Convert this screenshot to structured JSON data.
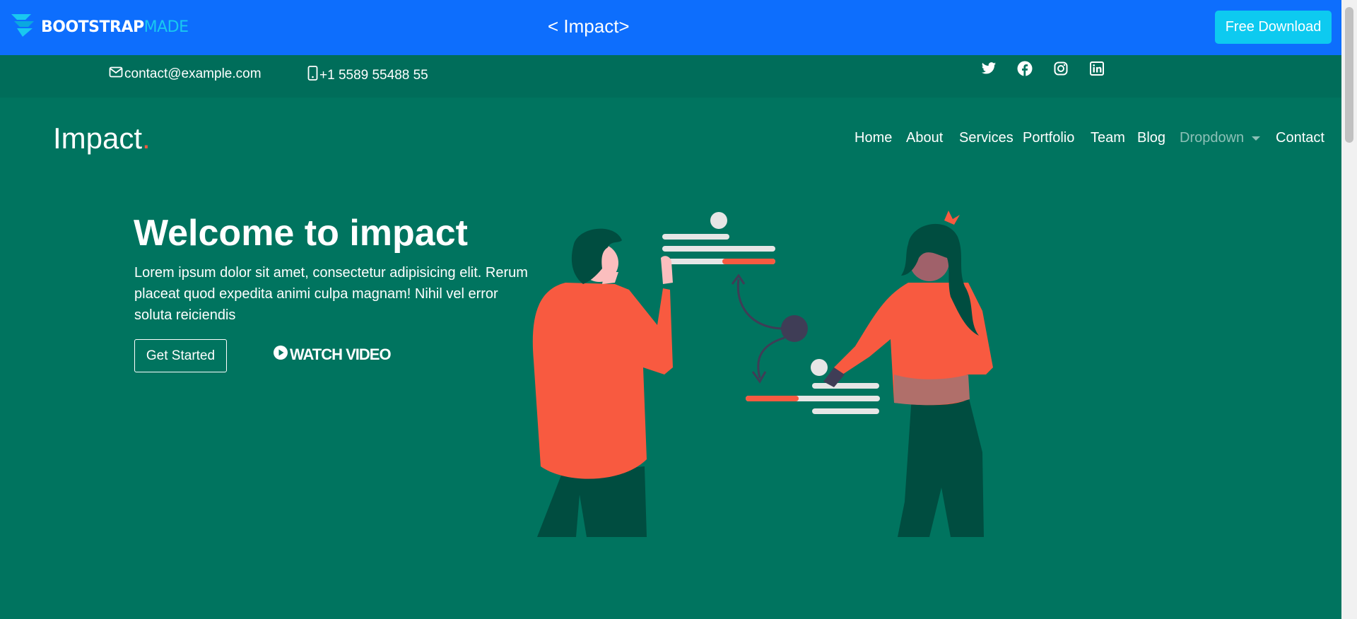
{
  "banner": {
    "logo_part1": "BOOTSTRAP",
    "logo_part2": "MADE",
    "title": "< Impact>",
    "download_label": "Free Download",
    "color": "#0d6efd",
    "download_color": "#0dcaf0"
  },
  "topbar": {
    "email": "contact@example.com",
    "phone": "+1 5589 55488 55",
    "email_icon": "envelope-icon",
    "phone_icon": "phone-icon",
    "socials": [
      "twitter-icon",
      "facebook-icon",
      "instagram-icon",
      "linkedin-icon"
    ]
  },
  "header": {
    "brand": "Impact",
    "brand_dot": ".",
    "nav": [
      "Home",
      "About",
      "Services",
      "Portfolio",
      "Team",
      "Blog",
      "Dropdown",
      "Contact"
    ]
  },
  "hero": {
    "title": "Welcome to impact",
    "description": "Lorem ipsum dolor sit amet, consectetur adipisicing elit. Rerum placeat quod expedita animi culpa magnam! Nihil vel error soluta reiciendis",
    "cta_label": "Get Started",
    "video_label": "WATCH VIDEO",
    "video_icon": "play-circle-icon"
  },
  "colors": {
    "background": "#00745f",
    "accent": "#f85a40"
  }
}
